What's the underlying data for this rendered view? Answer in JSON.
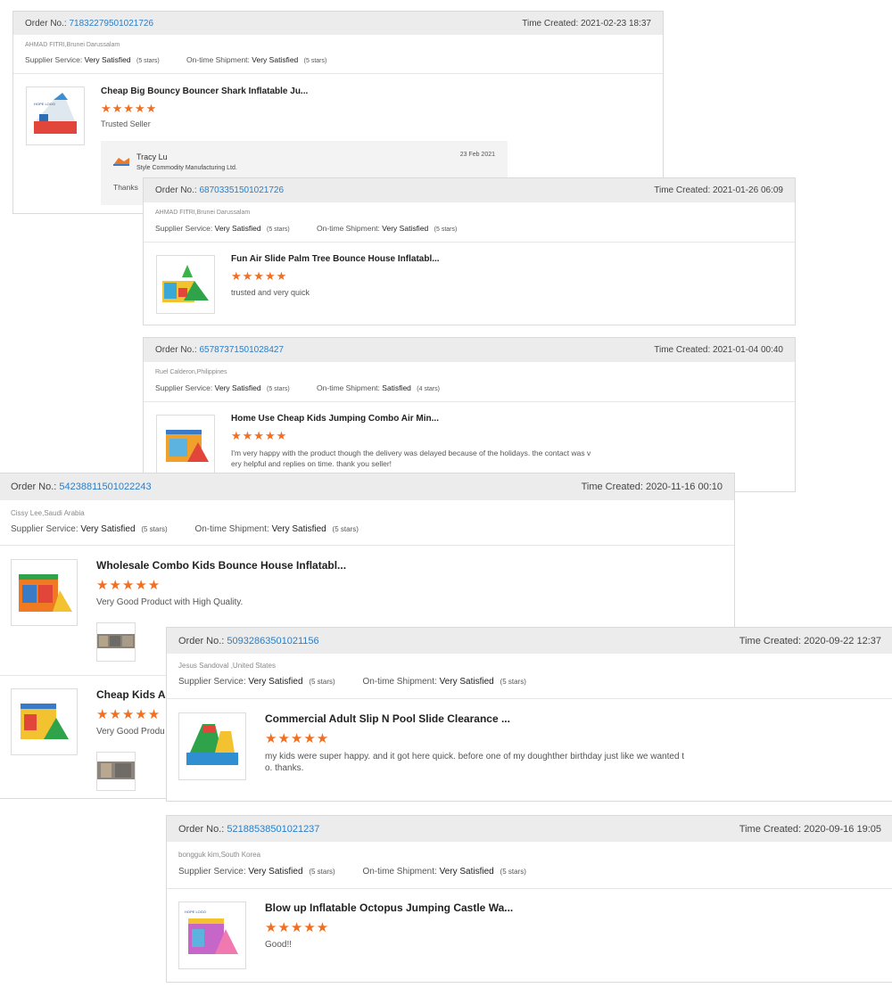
{
  "colors": {
    "accent_link": "#2a7ec7",
    "star": "#f26e21",
    "header_bg": "#ececec"
  },
  "labels": {
    "order_no": "Order No.:",
    "time_created": "Time Created:",
    "supplier_service": "Supplier Service:",
    "ontime_shipment": "On-time Shipment:"
  },
  "stars_glyph": "★★★★★",
  "reviews": [
    {
      "order_no": "71832279501021726",
      "time": "2021-02-23 18:37",
      "buyer": "AHMAD FITRI,Brunei Darussalam",
      "supplier_rating": "Very Satisfied",
      "supplier_stars": "(5 stars)",
      "shipment_rating": "Very Satisfied",
      "shipment_stars": "(5 stars)",
      "product_title": "Cheap Big Bouncy Bouncer Shark Inflatable Ju...",
      "comment": "Trusted Seller",
      "reply": {
        "name": "Tracy Lu",
        "company": "Style Commodity Manufacturing Ltd.",
        "date": "23 Feb 2021",
        "text": "Thanks"
      }
    },
    {
      "order_no": "68703351501021726",
      "time": "2021-01-26 06:09",
      "buyer": "AHMAD FITRI,Brunei Darussalam",
      "supplier_rating": "Very Satisfied",
      "supplier_stars": "(5 stars)",
      "shipment_rating": "Very Satisfied",
      "shipment_stars": "(5 stars)",
      "product_title": "Fun Air Slide Palm Tree Bounce House Inflatabl...",
      "comment": "trusted and very quick"
    },
    {
      "order_no": "65787371501028427",
      "time": "2021-01-04 00:40",
      "buyer": "Ruel Calderon,Philippines",
      "supplier_rating": "Very Satisfied",
      "supplier_stars": "(5 stars)",
      "shipment_rating": "Satisfied",
      "shipment_stars": "(4 stars)",
      "product_title": "Home Use Cheap Kids Jumping Combo Air Min...",
      "comment_line1": "I'm very happy with the product though the delivery was delayed because of the holidays. the contact was v",
      "comment_line2": "ery helpful and replies on time. thank you seller!"
    },
    {
      "order_no": "54238811501022243",
      "time": "2020-11-16 00:10",
      "buyer": "Cissy Lee,Saudi Arabia",
      "supplier_rating": "Very Satisfied",
      "supplier_stars": "(5 stars)",
      "shipment_rating": "Very Satisfied",
      "shipment_stars": "(5 stars)",
      "product_title": "Wholesale Combo Kids Bounce House Inflatabl...",
      "comment": "Very Good Product with High Quality.",
      "product2_title": "Cheap Kids Ai",
      "comment2": "Very Good Produ"
    },
    {
      "order_no": "50932863501021156",
      "time": "2020-09-22 12:37",
      "buyer": "Jesus Sandoval ,United States",
      "supplier_rating": "Very Satisfied",
      "supplier_stars": "(5 stars)",
      "shipment_rating": "Very Satisfied",
      "shipment_stars": "(5 stars)",
      "product_title": "Commercial Adult Slip N Pool Slide Clearance ...",
      "comment_line1": "my kids were super happy. and it got here quick. before one of my doughther birthday just like we wanted t",
      "comment_line2": "o. thanks."
    },
    {
      "order_no": "52188538501021237",
      "time": "2020-09-16 19:05",
      "buyer": "bongguk kim,South Korea",
      "supplier_rating": "Very Satisfied",
      "supplier_stars": "(5 stars)",
      "shipment_rating": "Very Satisfied",
      "shipment_stars": "(5 stars)",
      "product_title": "Blow up Inflatable Octopus Jumping Castle Wa...",
      "comment": "Good!!"
    }
  ]
}
